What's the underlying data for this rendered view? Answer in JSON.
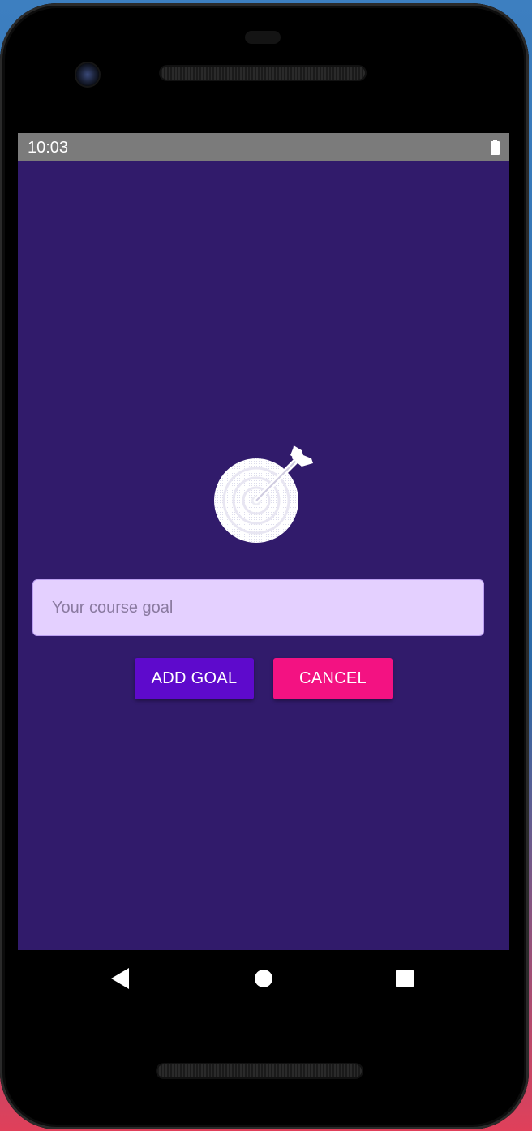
{
  "status_bar": {
    "time": "10:03",
    "battery_icon": "battery-full-icon"
  },
  "app": {
    "background_color": "#311b6b",
    "image_icon": "goal-target-icon",
    "goal_input": {
      "value": "",
      "placeholder": "Your course goal"
    },
    "add_button_label": "ADD GOAL",
    "cancel_button_label": "CANCEL",
    "add_button_color": "#5e0acc",
    "cancel_button_color": "#f31282"
  },
  "nav_bar": {
    "back_icon": "back-triangle-icon",
    "home_icon": "home-circle-icon",
    "recents_icon": "recents-square-icon"
  }
}
